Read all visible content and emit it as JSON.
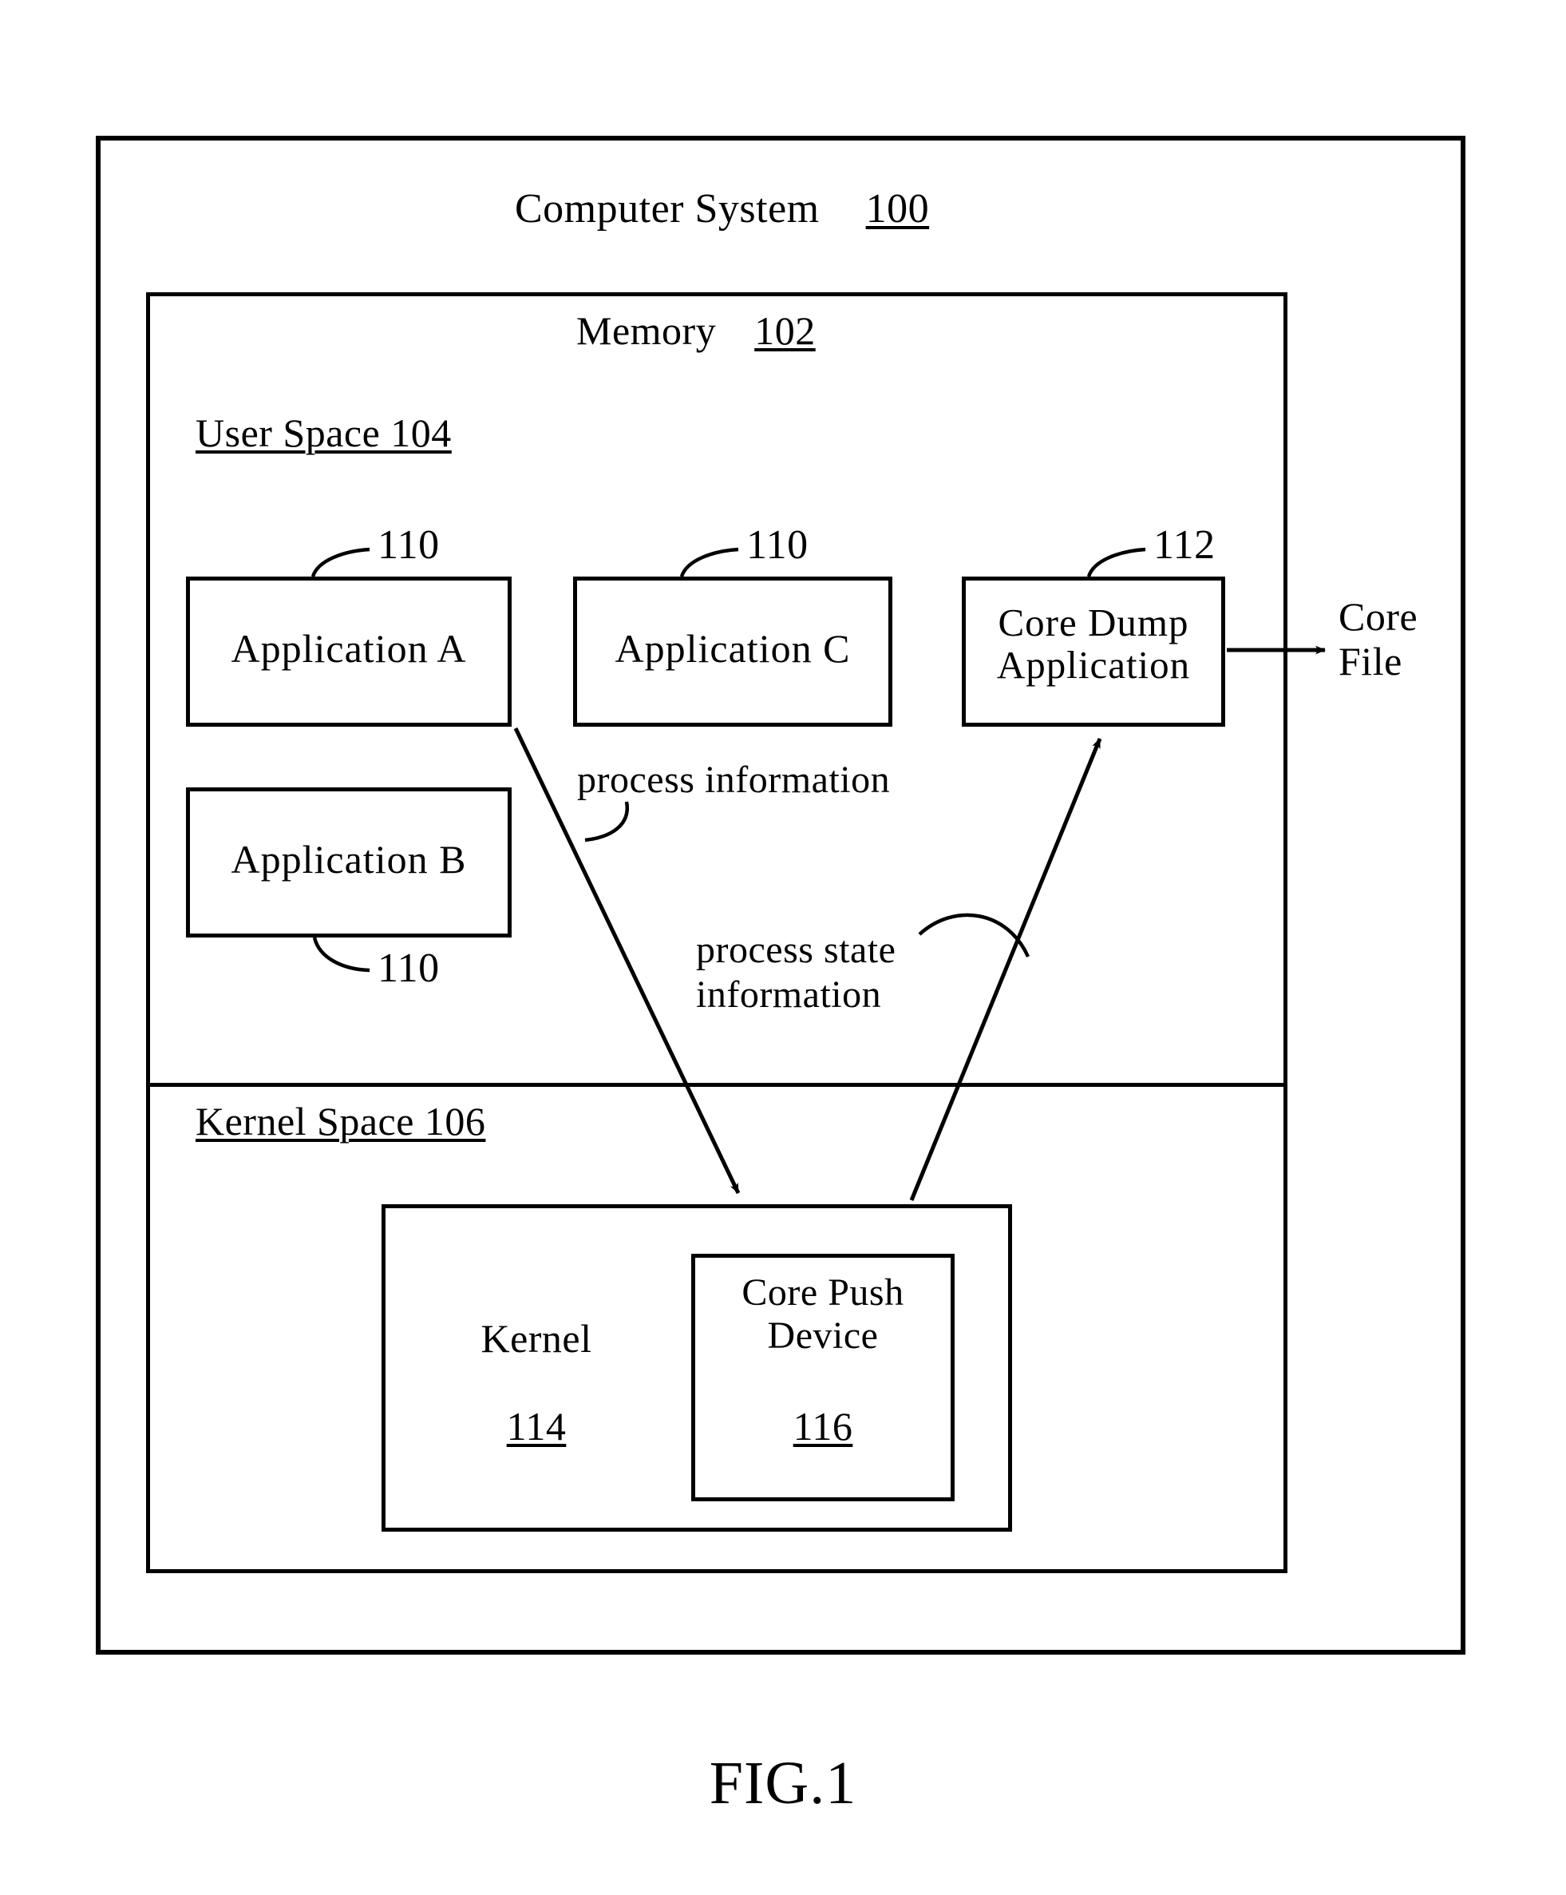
{
  "figure": {
    "caption": "FIG.1"
  },
  "computer_system": {
    "title": "Computer System",
    "ref": "100"
  },
  "memory": {
    "title": "Memory",
    "ref": "102"
  },
  "user_space": {
    "title": "User Space 104",
    "applications": [
      {
        "label": "Application A",
        "ref": "110"
      },
      {
        "label": "Application B",
        "ref": "110"
      },
      {
        "label": "Application C",
        "ref": "110"
      }
    ],
    "core_dump_application": {
      "line1": "Core Dump",
      "line2": "Application",
      "ref": "112"
    }
  },
  "kernel_space": {
    "title": "Kernel Space 106",
    "kernel": {
      "label": "Kernel",
      "ref": "114"
    },
    "core_push_device": {
      "line1": "Core Push",
      "line2": "Device",
      "ref": "116"
    }
  },
  "annotations": {
    "process_information": "process information",
    "process_state_information_line1": "process state",
    "process_state_information_line2": "information"
  },
  "outputs": {
    "core_file_line1": "Core",
    "core_file_line2": "File"
  },
  "colors": {
    "stroke": "#000000",
    "background": "#ffffff"
  }
}
